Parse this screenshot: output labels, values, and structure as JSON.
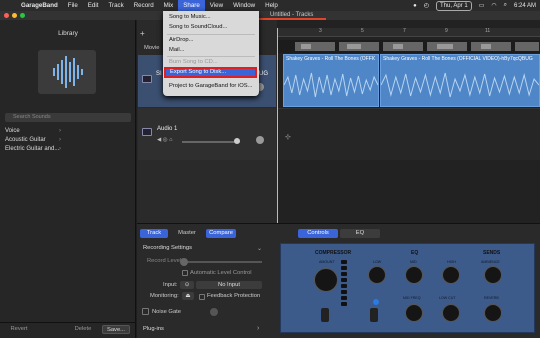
{
  "menubar": {
    "app": "GarageBand",
    "items": [
      "File",
      "Edit",
      "Track",
      "Record",
      "Mix",
      "Share",
      "View",
      "Window",
      "Help"
    ],
    "active": "Share",
    "status": {
      "date": "Thu, Apr 1",
      "time": "6:24 AM"
    }
  },
  "window": {
    "title": "Untitled - Tracks"
  },
  "share_menu": {
    "items": [
      {
        "label": "Song to Music...",
        "disabled": false
      },
      {
        "label": "Song to SoundCloud...",
        "disabled": false
      },
      {
        "label": "AirDrop...",
        "disabled": false
      },
      {
        "label": "Mail...",
        "disabled": false
      },
      {
        "label": "Burn Song to CD...",
        "disabled": true
      },
      {
        "label": "Export Song to Disk...",
        "disabled": false,
        "highlighted": true
      },
      {
        "label": "Project to GarageBand for iOS...",
        "disabled": false
      }
    ]
  },
  "library": {
    "title": "Library",
    "search_placeholder": "Search Sounds",
    "items": [
      "Voice",
      "Acoustic Guitar",
      "Electric Guitar and..."
    ],
    "buttons": {
      "revert": "Revert",
      "delete": "Delete",
      "save": "Save..."
    }
  },
  "tracks": {
    "movie_label": "Movie",
    "track1_name": "SI",
    "track1_suffix": "UG",
    "track2_name": "Audio 1",
    "ruler_marks": [
      "1",
      "3",
      "5",
      "7",
      "9",
      "11"
    ]
  },
  "regions": {
    "r1": "Shakey Graves - Roll The Bones (OFFICIAL",
    "r2": "Shakey Graves - Roll The Bones (OFFICIAL VIDEO)-hBy7qcQBUGQ 2"
  },
  "smart_controls": {
    "tabs": {
      "track": "Track",
      "master": "Master",
      "compare": "Compare",
      "controls": "Controls",
      "eq": "EQ"
    },
    "section": "Recording Settings",
    "record_level": "Record Level:",
    "auto_level": "Automatic Level Control",
    "input_label": "Input:",
    "input_value": "No Input",
    "monitoring_label": "Monitoring:",
    "feedback": "Feedback Protection",
    "noise_gate": "Noise Gate",
    "plugins": "Plug-ins"
  },
  "plugin": {
    "compressor": "COMPRESSOR",
    "eq": "EQ",
    "sends": "SENDS",
    "labels": {
      "amount": "AMOUNT",
      "low": "LOW",
      "mid": "MID",
      "high": "HIGH",
      "ambience": "AMBIENCE",
      "mid_freq": "MID FREQ",
      "low_cut": "LOW CUT",
      "reverb": "REVERB"
    }
  }
}
